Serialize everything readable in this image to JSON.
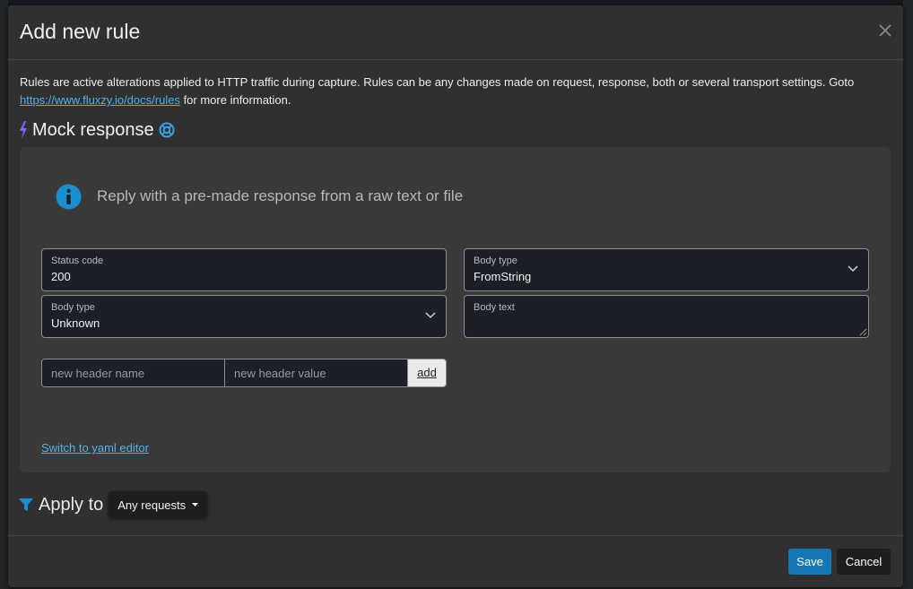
{
  "dialog": {
    "title": "Add new rule",
    "intro_text": "Rules are active alterations applied to HTTP traffic during capture. Rules can be any changes made on request, response, both or several transport settings. Goto",
    "intro_link": "https://www.fluxzy.io/docs/rules",
    "intro_suffix": "for more information."
  },
  "section": {
    "title": "Mock response",
    "info_text": "Reply with a pre-made response from a raw text or file"
  },
  "form": {
    "status_code_label": "Status code",
    "status_code_value": "200",
    "body_type_label": "Body type",
    "body_type_value": "FromString",
    "body_type2_label": "Body type",
    "body_type2_value": "Unknown",
    "body_text_label": "Body text",
    "header_name_placeholder": "new header name",
    "header_value_placeholder": "new header value",
    "add_label": "add",
    "yaml_link": "Switch to yaml editor"
  },
  "apply": {
    "label": "Apply to",
    "value": "Any requests"
  },
  "footer": {
    "save_label": "Save",
    "cancel_label": "Cancel"
  },
  "colors": {
    "accent": "#1577b3",
    "link": "#4fb3e8",
    "bolt": "#8b5cf6"
  }
}
